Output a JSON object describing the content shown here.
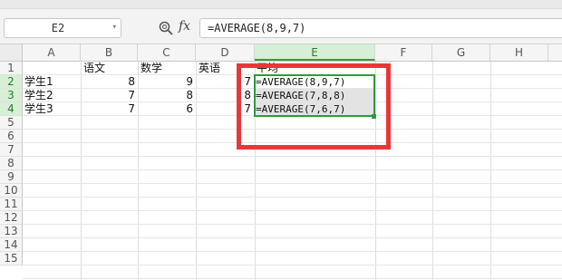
{
  "formula_bar": {
    "name_box": "E2",
    "fx_label": "fx",
    "formula": "=AVERAGE(8,9,7)"
  },
  "columns": [
    "A",
    "B",
    "C",
    "D",
    "E",
    "F",
    "G",
    "H"
  ],
  "selected_column": "E",
  "rows": [
    "1",
    "2",
    "3",
    "4",
    "5",
    "6",
    "7",
    "8",
    "9",
    "10",
    "11",
    "12",
    "13",
    "14",
    "15"
  ],
  "selected_rows": [
    "2",
    "3",
    "4"
  ],
  "sheet": {
    "headers": {
      "b": "语文",
      "c": "数学",
      "d": "英语",
      "e": "平均"
    },
    "data": [
      {
        "name": "学生1",
        "chinese": "8",
        "math": "9",
        "english": "7",
        "average": "=AVERAGE(8,9,7)"
      },
      {
        "name": "学生2",
        "chinese": "7",
        "math": "8",
        "english": "8",
        "average": "=AVERAGE(7,8,8)"
      },
      {
        "name": "学生3",
        "chinese": "7",
        "math": "6",
        "english": "7",
        "average": "=AVERAGE(7,6,7)"
      }
    ]
  },
  "colors": {
    "selection_border": "#2e9a3e",
    "highlight_box": "#e8373a"
  },
  "icons": {
    "zoom": "magnifier-icon",
    "name_box_caret": "chevron-down-icon"
  }
}
